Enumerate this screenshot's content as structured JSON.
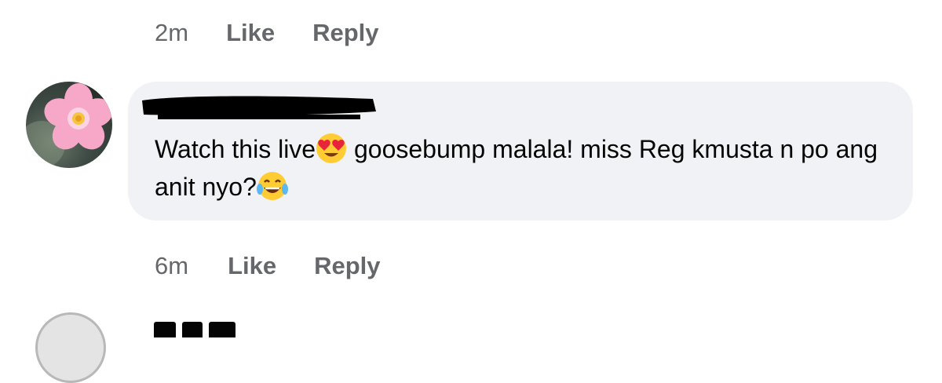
{
  "previous_comment": {
    "time": "2m",
    "like_label": "Like",
    "reply_label": "Reply"
  },
  "comment": {
    "author_name_redacted": true,
    "text_part1": "Watch this live",
    "emoji1": "heart-eyes-emoji",
    "text_part2": " goosebump malala! miss Reg kmusta n po ang anit nyo?",
    "emoji2": "tears-of-joy-emoji",
    "time": "6m",
    "like_label": "Like",
    "reply_label": "Reply"
  },
  "colors": {
    "bubble_bg": "#f0f2f5",
    "meta_text": "#65676b",
    "body_text": "#050505",
    "flower_pink": "#f7a8c8"
  }
}
